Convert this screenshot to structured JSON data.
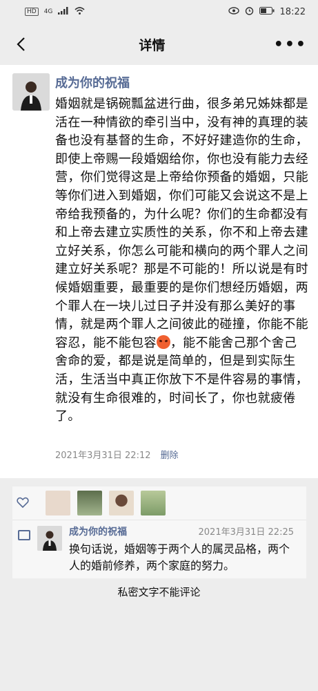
{
  "status": {
    "hd": "HD",
    "net": "4G",
    "time": "18:22"
  },
  "nav": {
    "title": "详情"
  },
  "post": {
    "author": "成为你的祝福",
    "content": "婚姻就是锅碗瓢盆进行曲，很多弟兄姊妹都是活在一种情欲的牵引当中，没有神的真理的装备也没有基督的生命，不好好建造你的生命，即使上帝赐一段婚姻给你，你也没有能力去经营，你们觉得这是上帝给你预备的婚姻，只能等你们进入到婚姻，你们可能又会说这不是上帝给我预备的，为什么呢？你们的生命都没有和上帝去建立实质性的关系，你不和上帝去建立好关系，你怎么可能和横向的两个罪人之间建立好关系呢？那是不可能的！所以说是有时候婚姻重要，最重要的是你们想经历婚姻，两个罪人在一块儿过日子并没有那么美好的事情，就是两个罪人之间彼此的碰撞，你能不能容忍，能不能包容",
    "content_after": "，能不能舍己那个舍己舍命的爱，都是说是简单的，但是到实际生活，生活当中真正你放下不是件容易的事情，就没有生命很难的，时间长了，你也就疲倦了。",
    "timestamp": "2021年3月31日 22:12",
    "delete_label": "删除"
  },
  "likes": {
    "icon": "heart-icon",
    "avatars": [
      "#e8d9cc",
      "#7a8f6a",
      "#c9a58f",
      "#8fae7a"
    ]
  },
  "comment": {
    "author": "成为你的祝福",
    "time": "2021年3月31日 22:25",
    "text": "换句话说，婚姻等于两个人的属灵品格，两个人的婚前修养，两个家庭的努力。"
  },
  "footer": {
    "private_note": "私密文字不能评论"
  },
  "colors": {
    "link": "#576b95",
    "background": "#ededed"
  }
}
